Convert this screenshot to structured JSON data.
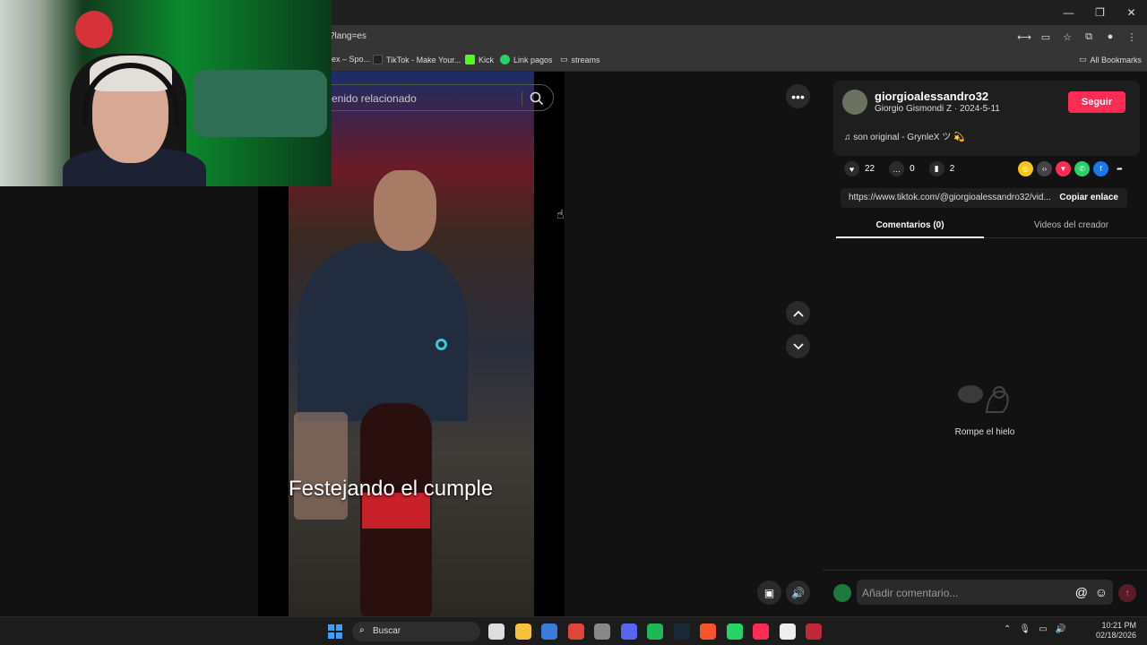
{
  "browser": {
    "url": "?lang=es",
    "window_controls": [
      "—",
      "❐",
      "✕"
    ],
    "bookmarks": [
      {
        "label": "ex – Spo...",
        "color": "#1db954"
      },
      {
        "label": "TikTok - Make Your...",
        "color": "#222222"
      },
      {
        "label": "Kick",
        "color": "#53fc18"
      },
      {
        "label": "Link pagos",
        "color": "#25d366"
      },
      {
        "label": "streams",
        "color": "#dddddd"
      }
    ],
    "all_bookmarks": "All Bookmarks"
  },
  "video": {
    "search_placeholder": "enido relacionado",
    "caption": "Festejando el cumple"
  },
  "panel": {
    "username": "giorgioalessandro32",
    "subline": "Giorgio Gismondi Z · 2024-5-11",
    "follow_label": "Seguir",
    "music": "♫  son original - GrynleX ツ 💫",
    "likes": "22",
    "comments": "0",
    "saves": "2",
    "share_colors": [
      "#f5c518",
      "#444444",
      "#fe2c55",
      "#25d366",
      "#1877f2"
    ],
    "link": "https://www.tiktok.com/@giorgioalessandro32/vid...",
    "copy_label": "Copiar enlace",
    "tab_comments": "Comentarios (0)",
    "tab_creator": "Videos del creador",
    "empty_text": "Rompe el hielo",
    "comment_placeholder": "Añadir comentario...",
    "accent_color": "#fe2c55"
  },
  "taskbar": {
    "search_label": "Buscar",
    "apps": [
      {
        "name": "task-view",
        "color": "#dddddd"
      },
      {
        "name": "file-explorer",
        "color": "#f5c13b"
      },
      {
        "name": "store",
        "color": "#3b7bd9"
      },
      {
        "name": "chrome",
        "color": "#e0453a"
      },
      {
        "name": "obs",
        "color": "#888888"
      },
      {
        "name": "discord",
        "color": "#5865f2"
      },
      {
        "name": "spotify",
        "color": "#1db954"
      },
      {
        "name": "steam",
        "color": "#1b2838"
      },
      {
        "name": "brave",
        "color": "#fb542b"
      },
      {
        "name": "whatsapp",
        "color": "#25d366"
      },
      {
        "name": "tiktok",
        "color": "#fe2c55"
      },
      {
        "name": "capcut",
        "color": "#eeeeee"
      },
      {
        "name": "streamer-app",
        "color": "#c0283a"
      }
    ],
    "time": "10:21 PM",
    "date": "02/18/2026"
  }
}
